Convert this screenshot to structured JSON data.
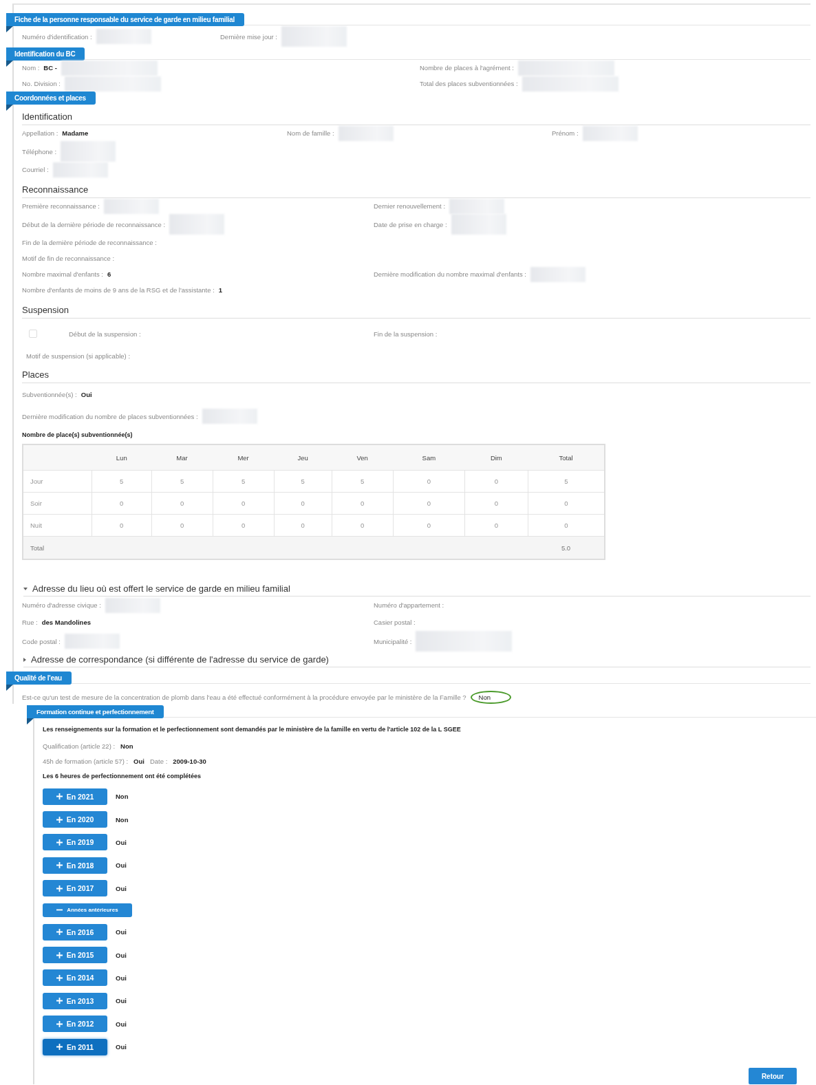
{
  "header": {
    "title": "Fiche de la personne responsable du service de garde en milieu familial",
    "rows": [
      [
        {
          "label": "Numéro d'identification :",
          "redacted": true
        },
        {
          "label": "Dernière mise jour :",
          "redacted": true
        }
      ]
    ]
  },
  "bc": {
    "title": "Identification du BC",
    "rows": [
      [
        {
          "label": "Nom :",
          "value": "BC -",
          "redacted": true
        },
        {
          "label": "Nombre de places à l'agrément :",
          "redacted": true
        }
      ],
      [
        {
          "label": "No. Division :",
          "redacted": true
        },
        {
          "label": "Total des places subventionnées :",
          "redacted": true
        }
      ]
    ]
  },
  "coordonnees": {
    "title": "Coordonnées et places",
    "identification": {
      "heading": "Identification",
      "rows": [
        [
          {
            "label": "Appellation :",
            "value": "Madame"
          },
          {
            "label": "Nom de famille :",
            "redacted": true
          },
          {
            "label": "Prénom :",
            "redacted": true
          }
        ],
        [
          {
            "label": "Téléphone :",
            "redacted": true
          }
        ],
        [
          {
            "label": "Courriel :",
            "redacted": true
          }
        ]
      ]
    },
    "reconnaissance": {
      "heading": "Reconnaissance",
      "rows": [
        [
          {
            "label": "Première reconnaissance :",
            "redacted": true
          },
          {
            "label": "Dernier renouvellement :",
            "redacted": true
          }
        ],
        [
          {
            "label": "Début de la dernière période de reconnaissance :",
            "redacted": true
          },
          {
            "label": "Date de prise en charge :",
            "redacted": true
          }
        ],
        [
          {
            "label": "Fin de la dernière période de reconnaissance :"
          }
        ],
        [
          {
            "label": "Motif de fin de reconnaissance :"
          }
        ],
        [
          {
            "label": "Nombre maximal d'enfants :",
            "value": "6"
          },
          {
            "label": "Dernière modification du nombre maximal d'enfants :",
            "redacted": true
          }
        ],
        [
          {
            "label": "Nombre d'enfants de moins de 9 ans de la RSG et de l'assistante :",
            "value": "1"
          }
        ]
      ]
    },
    "suspension": {
      "heading": "Suspension",
      "checked": false,
      "start_label": "Début de la suspension :",
      "end_label": "Fin de la suspension :",
      "reason_label": "Motif de suspension (si applicable) :"
    },
    "places": {
      "heading": "Places",
      "rows": [
        [
          {
            "label": "Subventionnée(s) :",
            "value": "Oui"
          }
        ],
        [
          {
            "label": "Dernière modification du nombre de places subventionnées :",
            "redacted": true
          }
        ]
      ],
      "table_title": "Nombre de place(s) subventionnée(s)",
      "table": {
        "columns": [
          "",
          "Lun",
          "Mar",
          "Mer",
          "Jeu",
          "Ven",
          "Sam",
          "Dim",
          "Total"
        ],
        "rows": [
          [
            "Jour",
            "5",
            "5",
            "5",
            "5",
            "5",
            "0",
            "0",
            "5"
          ],
          [
            "Soir",
            "0",
            "0",
            "0",
            "0",
            "0",
            "0",
            "0",
            "0"
          ],
          [
            "Nuit",
            "0",
            "0",
            "0",
            "0",
            "0",
            "0",
            "0",
            "0"
          ]
        ],
        "total_label": "Total",
        "total": "5.0"
      }
    },
    "address": {
      "heading": "Adresse du lieu où est offert le service de garde en milieu familial",
      "expanded": true,
      "rows": [
        [
          {
            "label": "Numéro d'adresse civique :",
            "redacted": true
          },
          {
            "label": "Numéro d'appartement :"
          }
        ],
        [
          {
            "label": "Rue :",
            "value": "des Mandolines"
          },
          {
            "label": "Casier postal :"
          }
        ],
        [
          {
            "label": "Code postal :",
            "redacted": true
          },
          {
            "label": "Municipalité :",
            "redacted": true
          }
        ]
      ]
    },
    "mail_address": {
      "heading": "Adresse de correspondance (si différente de l'adresse du service de garde)",
      "expanded": false
    }
  },
  "water": {
    "title": "Qualité de l'eau",
    "question": "Est-ce qu'un test de mesure de la concentration de plomb dans l'eau a été effectué conformément à la procédure envoyée par le ministère de la Famille ?",
    "answer": "Non",
    "circled": true
  },
  "training": {
    "title": "Formation continue et perfectionnement",
    "notice": "Les renseignements sur la formation et le perfectionnement sont demandés par le ministère de la famille en vertu de l'article 102 de la L SGEE",
    "qualification": {
      "label": "Qualification (article 22) :",
      "value": "Non"
    },
    "hours45": {
      "label": "45h de formation (article 57) :",
      "value": "Oui",
      "date_label": "Date :",
      "date": "2009-10-30"
    },
    "hours6": "Les 6 heures de perfectionnement ont été complétées",
    "years": [
      {
        "kind": "year",
        "label": "En 2021",
        "answer": "Non",
        "focused": false
      },
      {
        "kind": "year",
        "label": "En 2020",
        "answer": "Non",
        "focused": false
      },
      {
        "kind": "year",
        "label": "En 2019",
        "answer": "Oui",
        "focused": false
      },
      {
        "kind": "year",
        "label": "En 2018",
        "answer": "Oui",
        "focused": false
      },
      {
        "kind": "year",
        "label": "En 2017",
        "answer": "Oui",
        "focused": false
      },
      {
        "kind": "toggle",
        "label": "Années antérieures",
        "expanded": true
      },
      {
        "kind": "year",
        "label": "En 2016",
        "answer": "Oui",
        "focused": false
      },
      {
        "kind": "year",
        "label": "En 2015",
        "answer": "Oui",
        "focused": false
      },
      {
        "kind": "year",
        "label": "En 2014",
        "answer": "Oui",
        "focused": false
      },
      {
        "kind": "year",
        "label": "En 2013",
        "answer": "Oui",
        "focused": false
      },
      {
        "kind": "year",
        "label": "En 2012",
        "answer": "Oui",
        "focused": false
      },
      {
        "kind": "year",
        "label": "En 2011",
        "answer": "Oui",
        "focused": true
      }
    ]
  },
  "back_button": "Retour"
}
